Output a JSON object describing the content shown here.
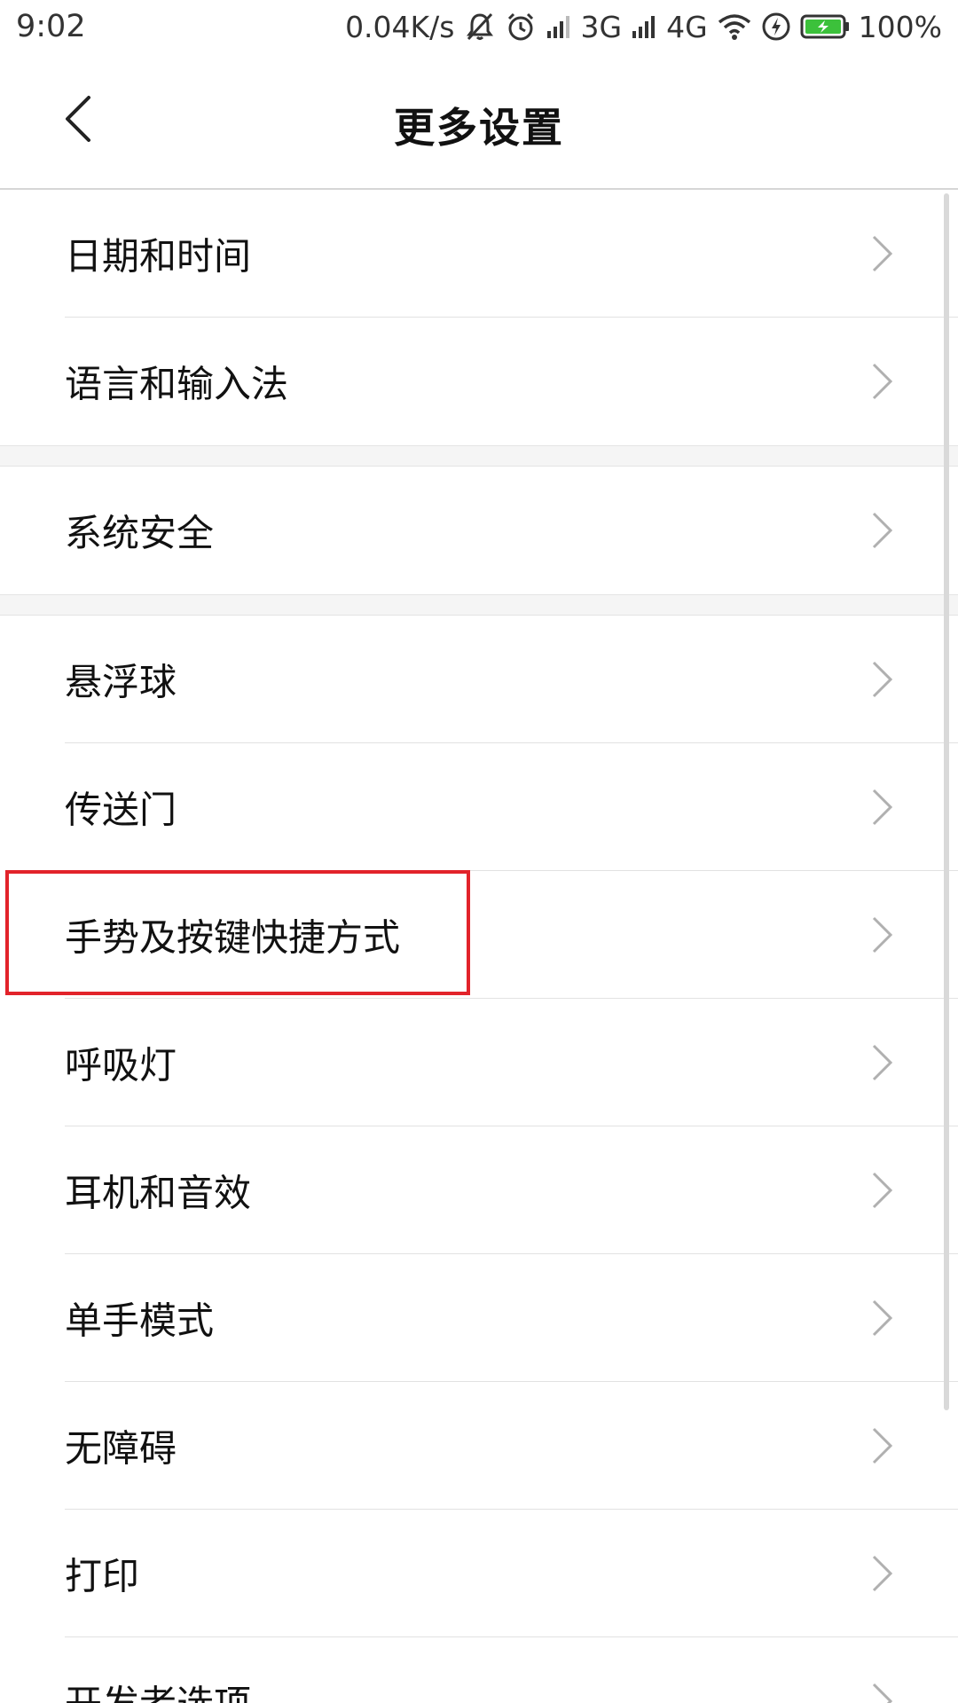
{
  "status_bar": {
    "time": "9:02",
    "speed": "0.04K/s",
    "network_3g": "3G",
    "network_4g": "4G",
    "battery_percent": "100%",
    "icons": [
      "mute-bell-icon",
      "alarm-icon",
      "signal-icon",
      "signal-icon",
      "wifi-icon",
      "flash-icon",
      "battery-charging-icon"
    ],
    "battery_color": "#3cc13b"
  },
  "header": {
    "title": "更多设置",
    "back_icon": "back-arrow-icon"
  },
  "settings": {
    "group1": [
      {
        "label": "日期和时间"
      },
      {
        "label": "语言和输入法"
      }
    ],
    "group2": [
      {
        "label": "系统安全"
      }
    ],
    "group3": [
      {
        "label": "悬浮球"
      },
      {
        "label": "传送门"
      },
      {
        "label": "手势及按键快捷方式"
      },
      {
        "label": "呼吸灯"
      },
      {
        "label": "耳机和音效"
      },
      {
        "label": "单手模式"
      },
      {
        "label": "无障碍"
      },
      {
        "label": "打印"
      },
      {
        "label": "开发者选项"
      }
    ]
  },
  "highlight_color": "#e2232a"
}
